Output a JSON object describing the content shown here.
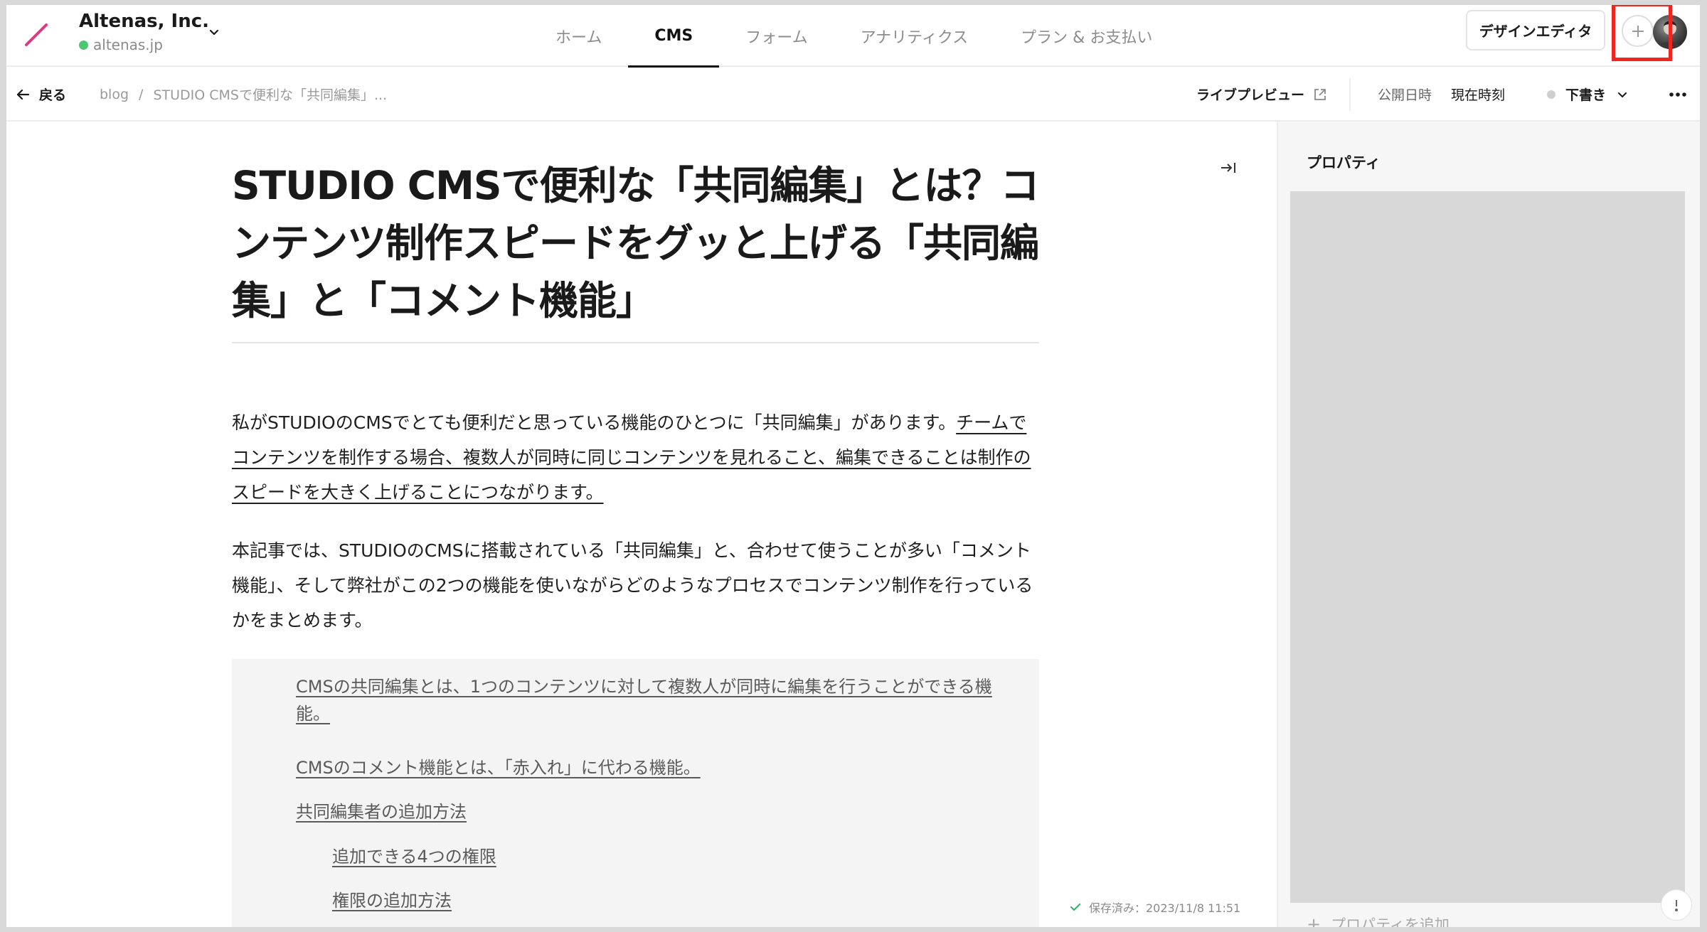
{
  "workspace": {
    "name": "Altenas, Inc.",
    "domain": "altenas.jp"
  },
  "nav": {
    "tabs": [
      {
        "label": "ホーム",
        "active": false
      },
      {
        "label": "CMS",
        "active": true
      },
      {
        "label": "フォーム",
        "active": false
      },
      {
        "label": "アナリティクス",
        "active": false
      },
      {
        "label": "プラン & お支払い",
        "active": false
      }
    ]
  },
  "header": {
    "design_editor_label": "デザインエディタ"
  },
  "subbar": {
    "back_label": "戻る",
    "breadcrumb": [
      "blog",
      "STUDIO CMSで便利な「共同編集」..."
    ],
    "breadcrumb_separator": "/",
    "live_preview_label": "ライブプレビュー",
    "publish_date_label": "公開日時",
    "publish_date_value": "現在時刻",
    "status_value": "下書き"
  },
  "article": {
    "title": "STUDIO CMSで便利な「共同編集」とは？コンテンツ制作スピードをグッと上げる「共同編集」と「コメント機能」",
    "para1_plain": "私がSTUDIOのCMSでとても便利だと思っている機能のひとつに「共同編集」があります。",
    "para1_underlined": "チームでコンテンツを制作する場合、複数人が同時に同じコンテンツを見れること、編集できることは制作のスピードを大きく上げることにつながります。",
    "para2": "本記事では、STUDIOのCMSに搭載されている「共同編集」と、合わせて使うことが多い「コメント機能」、そして弊社がこの2つの機能を使いながらどのようなプロセスでコンテンツ制作を行っているかをまとめます。",
    "toc": [
      {
        "label": "CMSの共同編集とは、1つのコンテンツに対して複数人が同時に編集を行うことができる機能。",
        "level": 1
      },
      {
        "label": "CMSのコメント機能とは、「赤入れ」に代わる機能。",
        "level": 1
      },
      {
        "label": "共同編集者の追加方法",
        "level": 1
      },
      {
        "label": "追加できる4つの権限",
        "level": 2
      },
      {
        "label": "権限の追加方法",
        "level": 2
      }
    ],
    "saved_status": "保存済み：2023/11/8 11:51"
  },
  "properties_panel": {
    "title": "プロパティ",
    "add_property_label": "プロパティを追加"
  },
  "colors": {
    "accent_highlight": "#f0261e",
    "logo_stroke": "#e8337e",
    "status_online": "#4cc873"
  },
  "icons": {
    "logo": "studio-logo-slash",
    "org_switcher": "chevron-down-icon",
    "add": "plus-icon",
    "back": "arrow-left-icon",
    "external": "external-link-icon",
    "more": "ellipsis-icon",
    "collapse": "collapse-panel-icon",
    "saved": "check-icon"
  }
}
